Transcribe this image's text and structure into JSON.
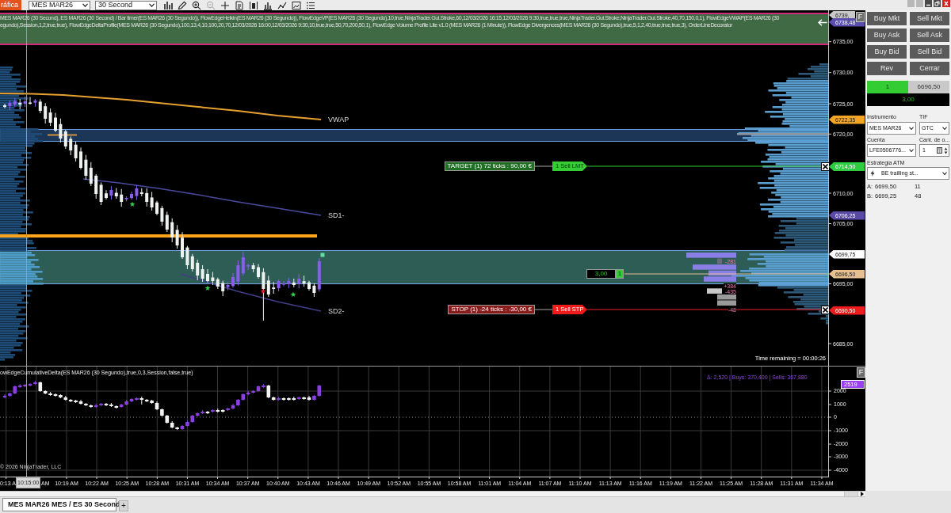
{
  "toolbar": {
    "app_button": "ráfica",
    "instrument": "MES MAR26",
    "interval": "30 Second",
    "tools": [
      {
        "kind": "bars",
        "disabled": false
      },
      {
        "kind": "pencil",
        "disabled": false
      },
      {
        "kind": "zoom_in",
        "disabled": false
      },
      {
        "kind": "zoom_out",
        "disabled": true
      },
      {
        "kind": "crosshair",
        "disabled": false
      },
      {
        "kind": "properties",
        "disabled": false
      },
      {
        "kind": "bar_range",
        "disabled": false
      },
      {
        "kind": "indicators",
        "disabled": false
      },
      {
        "kind": "line_chart",
        "disabled": false
      },
      {
        "kind": "snapshot",
        "disabled": false
      },
      {
        "kind": "list",
        "disabled": false
      }
    ]
  },
  "chart": {
    "legend_lines": [
      "MES MAR26 (30 Second), ES MAR26 (30 Second) / Bar timer(ES MAR26 (30 Segundo)), FlowEdgeHeikin(ES MAR26 (30 Segundo)), FlowEdgeVP(ES MAR26 (30 Segundo),10,true,NinjaTrader.Gui.Stroke,60,12/03/2026 16:15,12/03/2026 9:30,true,true,true,NinjaTrader.Gui.Stroke,NinjaTrader.Gui.Stroke,40,70,150,0,1), FlowEdgeVWAP(ES MAR26 (30",
      "egundo),Session,1,2,true,true), FlowEdgeDeltaProfile(MES MAR26 (30 Segundo),100,13,4,10,100,20,70,12/03/2026 16:00,12/03/2026 9:30,10,true,true,50,70,200,50,1), FlowEdge Volume Profile Lite v1.0 (MES MAR26 (1 Minute)), FlowEdge Divergences(MES MAR26 (30 Segundo),true,5,1,2,40,true,true,true,3), OrderLineDecorator"
    ],
    "float_button": "F",
    "curve_labels": [
      "VWAP",
      "SD1-",
      "SD2-"
    ],
    "orders": [
      {
        "kind": "target",
        "label": "TARGET (1) 72 ticks : 90,00 €",
        "tag": "1 Sell LMT"
      },
      {
        "kind": "stop",
        "label": "STOP (1) -24 ticks : -30,00 €",
        "tag": "1 Sell STP"
      }
    ],
    "position": {
      "pnl": "3,00",
      "quantity": "1"
    },
    "delta_profile": [
      {
        "value": "-281"
      },
      {
        "value": "+384"
      },
      {
        "value": "-435"
      },
      {
        "value": "-48"
      }
    ],
    "markers": [
      {
        "kind": "star",
        "color": "#2fd24a"
      },
      {
        "kind": "star",
        "color": "#2fd24a"
      },
      {
        "kind": "star",
        "color": "#ee2222"
      },
      {
        "kind": "star",
        "color": "#2fd24a"
      },
      {
        "kind": "square",
        "color": "#5fe0a0"
      }
    ],
    "time_remaining": "Time remaining = 00:00:26",
    "price_axis": {
      "ticks": [
        "6735,00",
        "6730,00",
        "6725,00",
        "6720,00",
        "6710,00",
        "6705,00",
        "6695,00",
        "6685,00"
      ],
      "tags": [
        {
          "text": "6739,",
          "color": "#c8c8c8"
        },
        {
          "text": "6738,48",
          "color": "#5a4fb0"
        },
        {
          "text": "6722,35",
          "color": "#f5a524"
        },
        {
          "text": "6714,50",
          "color": "#2ecc40"
        },
        {
          "text": "6706,25",
          "color": "#5a4aa8"
        },
        {
          "text": "6699,75",
          "color": "#ffffff"
        },
        {
          "text": "6696,50",
          "color": "#e6c08e"
        },
        {
          "text": "6690,50",
          "color": "#ee1c1c"
        }
      ]
    },
    "indicator": {
      "legend": "owEdgeCumulativeDelta(ES MAR26 (30 Segundo),true,0,3,Session,false,true)",
      "stats": "Δ: 2,520 | Buys: 370,400 | Sells: 367,880",
      "float_button": "F",
      "last_value": "2519",
      "ticks": [
        "2000",
        "1000",
        "0",
        "-1000",
        "-2000",
        "-3000",
        "-4000"
      ],
      "copyright": "© 2026 NinjaTrader, LLC"
    },
    "time_axis": {
      "crosshair_label": "10:15:00",
      "labels": [
        "0:13 A",
        "AM",
        "10:19 AM",
        "10:22 AM",
        "10:25 AM",
        "10:28 AM",
        "10:31 AM",
        "10:34 AM",
        "10:37 AM",
        "10:40 AM",
        "10:43 AM",
        "10:46 AM",
        "10:49 AM",
        "10:52 AM",
        "10:55 AM",
        "10:58 AM",
        "11:01 AM",
        "11:04 AM",
        "11:07 AM",
        "11:10 AM",
        "11:13 AM",
        "11:16 AM",
        "11:19 AM",
        "11:22 AM",
        "11:25 AM",
        "11:28 AM",
        "11:31 AM",
        "11:34 AM"
      ]
    }
  },
  "order_panel": {
    "buttons": [
      "Buy Mkt",
      "Sell Mkt",
      "Buy Ask",
      "Sell Ask",
      "Buy Bid",
      "Sell Bid",
      "Rev",
      "Cerrar"
    ],
    "position": {
      "quantity": "1",
      "price": "6696,50",
      "pnl": "3,00"
    },
    "instrument": {
      "label": "Instrumento",
      "value": "MES MAR26"
    },
    "tif": {
      "label": "TIF",
      "value": "GTC"
    },
    "account": {
      "label": "Cuenta",
      "value": "LFE0506776..."
    },
    "order_quantity": {
      "label": "Cant. de o...",
      "value": "1"
    },
    "atm_strategy": {
      "label": "Estrategia ATM",
      "value": "BE trailling st..."
    },
    "quotes": [
      {
        "side": "A:",
        "price": "6699,50",
        "size": "11"
      },
      {
        "side": "B:",
        "price": "6699,25",
        "size": "48"
      }
    ]
  },
  "tabs": [
    {
      "label": "MES MAR26 MES / ES 30 Second",
      "selected": true
    }
  ],
  "add_tab": "+"
}
